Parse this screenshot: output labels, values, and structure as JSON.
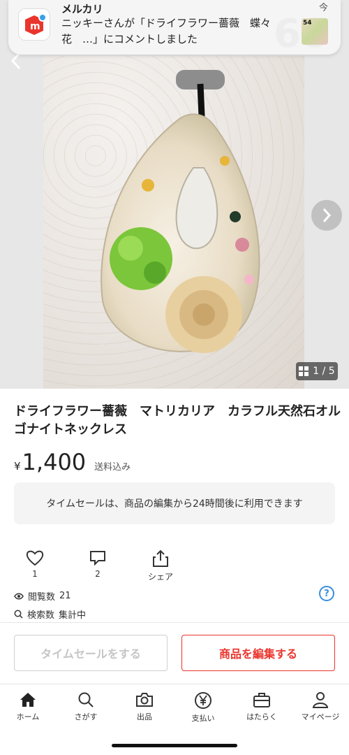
{
  "notification": {
    "app_name": "メルカリ",
    "message": "ニッキーさんが「ドライフラワー薔薇　蝶々　花　…」にコメントしました",
    "time": "今",
    "thumb_label": "54"
  },
  "gallery": {
    "badge": "68",
    "counter": "1 / 5"
  },
  "product": {
    "title": "ドライフラワー薔薇　マトリカリア　カラフル天然石オルゴナイトネックレス",
    "currency": "¥",
    "price": "1,400",
    "shipping": "送料込み",
    "notice": "タイムセールは、商品の編集から24時間後に利用できます"
  },
  "actions": [
    {
      "icon": "heart-icon",
      "label": "1"
    },
    {
      "icon": "comment-icon",
      "label": "2"
    },
    {
      "icon": "share-icon",
      "label": "シェア"
    }
  ],
  "stats": {
    "views_label": "閲覧数",
    "views_value": "21",
    "search_label": "検索数",
    "search_value": "集計中",
    "help_icon": "?"
  },
  "buttons": {
    "time_sale": "タイムセールをする",
    "edit": "商品を編集する"
  },
  "tabs": [
    {
      "icon": "home-icon",
      "label": "ホーム"
    },
    {
      "icon": "search-icon",
      "label": "さがす"
    },
    {
      "icon": "camera-icon",
      "label": "出品"
    },
    {
      "icon": "yen-icon",
      "label": "支払い"
    },
    {
      "icon": "briefcase-icon",
      "label": "はたらく"
    },
    {
      "icon": "person-icon",
      "label": "マイページ"
    }
  ],
  "colors": {
    "accent": "#ea352d",
    "link": "#3a8ede"
  }
}
